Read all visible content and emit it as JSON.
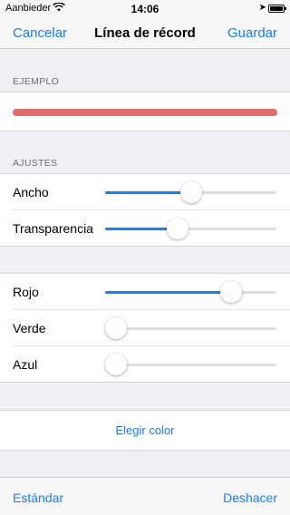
{
  "status": {
    "carrier": "Aanbieder",
    "time": "14:06"
  },
  "nav": {
    "cancel": "Cancelar",
    "title": "Línea de récord",
    "save": "Guardar"
  },
  "example": {
    "header": "EJEMPLO",
    "line_color": "#e06c6c"
  },
  "settings": {
    "header": "AJUSTES",
    "width_label": "Ancho",
    "width_value": 0.5,
    "transparency_label": "Transparencia",
    "transparency_value": 0.41
  },
  "color": {
    "red_label": "Rojo",
    "red_value": 0.77,
    "green_label": "Verde",
    "green_value": 0.0,
    "blue_label": "Azul",
    "blue_value": 0.0
  },
  "choose_color": "Elegir color",
  "toolbar": {
    "default": "Estándar",
    "undo": "Deshacer"
  },
  "accent_color": "#1a7ef5"
}
